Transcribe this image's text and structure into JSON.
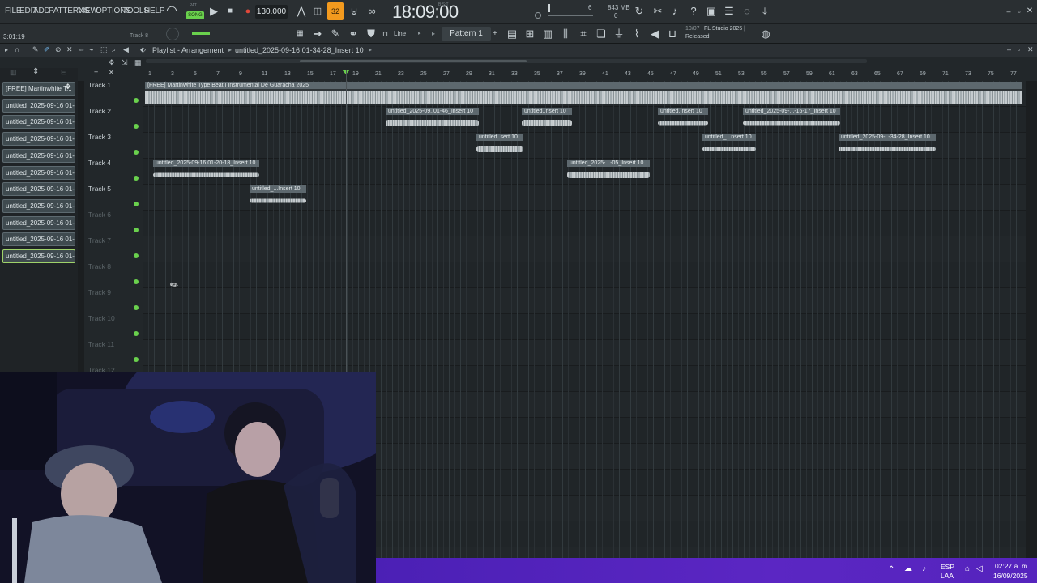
{
  "menu": [
    "FILE",
    "EDIT",
    "ADD",
    "PATTERNS",
    "VIEW",
    "OPTIONS",
    "TOOLS",
    "HELP"
  ],
  "transport": {
    "mode": "SONG",
    "mode_top": "PAT",
    "tempo": "130.000",
    "time": "18:09:00",
    "time_label": "B:S:T",
    "record_count": "32",
    "cpu_num": "6",
    "mem": "843 MB",
    "mem_sub": "0"
  },
  "toolbar2": {
    "position": "3:01:19",
    "track_hint": "Track 8",
    "snap": "Line",
    "pattern": "Pattern 1",
    "news_date": "10/07",
    "news_title": "FL Studio 2025 |",
    "news_sub": "Released"
  },
  "playlist": {
    "title": "Playlist - Arrangement",
    "breadcrumb": "untitled_2025-09-16 01-34-28_Insert 10"
  },
  "ruler": [
    "1",
    "3",
    "5",
    "7",
    "9",
    "11",
    "13",
    "15",
    "17",
    "19",
    "21",
    "23",
    "25",
    "27",
    "29",
    "31",
    "33",
    "35",
    "37",
    "39",
    "41",
    "43",
    "45",
    "47",
    "49",
    "51",
    "53",
    "55",
    "57",
    "59",
    "61",
    "63",
    "65",
    "67",
    "69",
    "71",
    "73",
    "75",
    "77"
  ],
  "browser_clips": [
    "[FREE] Martinwhite T...",
    "untitled_2025-09-16 01-...",
    "untitled_2025-09-16 01-...",
    "untitled_2025-09-16 01-...",
    "untitled_2025-09-16 01-...",
    "untitled_2025-09-16 01-...",
    "untitled_2025-09-16 01-...",
    "untitled_2025-09-16 01-...",
    "untitled_2025-09-16 01-...",
    "untitled_2025-09-16 01-...",
    "untitled_2025-09-16 01-..."
  ],
  "tracks": [
    "Track 1",
    "Track 2",
    "Track 3",
    "Track 4",
    "Track 5",
    "Track 6",
    "Track 7",
    "Track 8",
    "Track 9",
    "Track 10",
    "Track 11",
    "Track 12"
  ],
  "clips": {
    "c1": "[FREE] Martinwhite Type Beat I Instrumental De Guaracha 2025",
    "c2": "untitled_2025-09..01-46_Insert 10",
    "c3": "untitled..nsert 10",
    "c4": "untitled..nsert 10",
    "c5": "untitled_2025-09-...-16-17_Insert 10",
    "c6": "untitled..sert 10",
    "c7": "untitled_...nsert 10",
    "c8": "untitled_2025-09-..-34-28_Insert 10",
    "c9": "untitled_2025-09-16 01-20-18_Insert 10",
    "c10": "untitled_2025-...-05_Insert 10",
    "c11": "untitled_...Insert 10"
  },
  "taskbar": {
    "lang": "ESP",
    "lang2": "LAA",
    "clock": "02:27 a. m.",
    "date": "16/09/2025"
  },
  "colors": {
    "accent_orange": "#f39a1e",
    "led_green": "#6ad14d",
    "taskbar_purple": "#5524bd"
  }
}
